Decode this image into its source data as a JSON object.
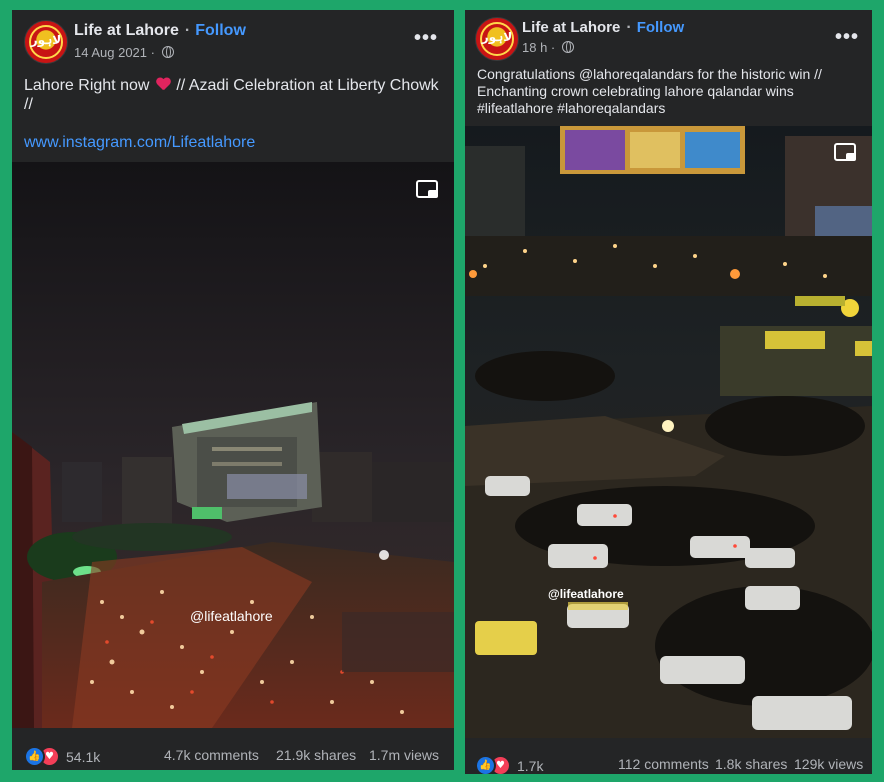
{
  "posts": [
    {
      "page_name": "Life at Lahore",
      "follow_label": "Follow",
      "timestamp": "14 Aug 2021",
      "caption_before_emoji": "Lahore Right now",
      "caption_emoji": "red-heart",
      "caption_after_emoji": " // Azadi Celebration at Liberty Chowk",
      "caption_line2": "//",
      "link_text": "www.instagram.com/Lifeatlahore",
      "watermark": "@lifeatlahore",
      "reaction_count": "54.1k",
      "comments": "4.7k comments",
      "shares": "21.9k shares",
      "views": "1.7m views"
    },
    {
      "page_name": "Life at Lahore",
      "follow_label": "Follow",
      "timestamp": "18 h",
      "caption_line1": "Congratulations @lahoreqalandars for the historic win //",
      "caption_line2": "Enchanting crown celebrating lahore qalandar wins",
      "caption_line3": "#lifeatlahore #lahoreqalandars",
      "watermark": "@lifeatlahore",
      "reaction_count": "1.7k",
      "comments": "112 comments",
      "shares": "1.8k shares",
      "views": "129k views"
    }
  ],
  "colors": {
    "frame_green": "#1ea66a",
    "card_bg": "#242526",
    "link_blue": "#4599ff",
    "text_primary": "#e4e6eb",
    "text_secondary": "#b0b3b8"
  },
  "icons": {
    "avatar_logo": "life-at-lahore-logo",
    "privacy": "globe-icon",
    "menu": "more-options-icon",
    "pip": "picture-in-picture-icon",
    "reactions": [
      "like-reaction-icon",
      "love-reaction-icon"
    ]
  }
}
